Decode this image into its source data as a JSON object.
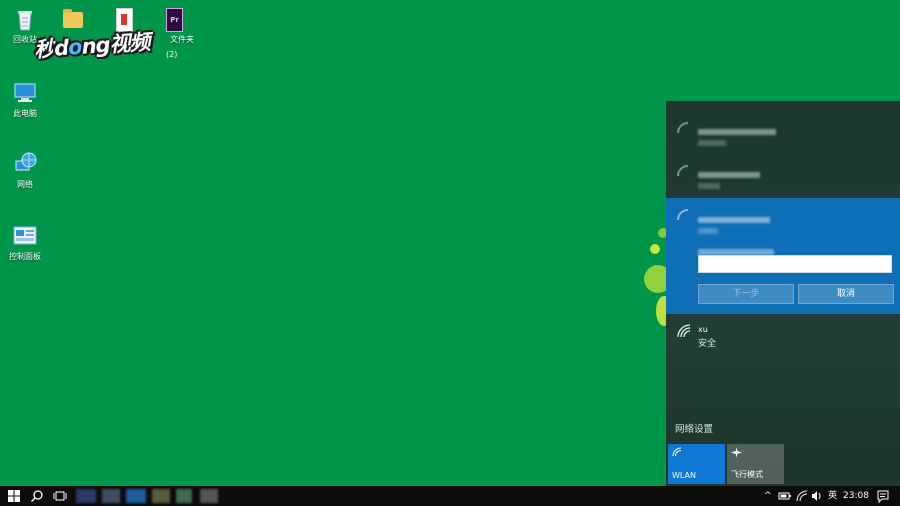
{
  "desktop": {
    "icons": [
      {
        "label": "回收站"
      },
      {
        "label": ""
      },
      {
        "label": ""
      },
      {
        "label": "文件夹"
      },
      {
        "label": "此电脑"
      },
      {
        "label": "网络"
      },
      {
        "label": "控制面板"
      }
    ],
    "extra_label": "(2)",
    "watermark": "秒懂视频",
    "watermark_prefix": "秒",
    "watermark_mid": "d",
    "watermark_o": "o",
    "watermark_suffix": "ng视频"
  },
  "network_flyout": {
    "selected_network": {
      "password_value": "",
      "next_label": "下一步",
      "cancel_label": "取消"
    },
    "xu": {
      "name": "xu",
      "status": "安全"
    },
    "settings_link": "网络设置",
    "tiles": [
      {
        "label": "WLAN",
        "active": true
      },
      {
        "label": "飞行模式",
        "active": false
      }
    ]
  },
  "taskbar": {
    "ime": "英",
    "time": "23:08"
  },
  "colors": {
    "desktop_bg": "#00964a",
    "flyout_bg": "#26443a",
    "accent": "#0f6fb6",
    "taskbar": "#0c0c0c"
  }
}
